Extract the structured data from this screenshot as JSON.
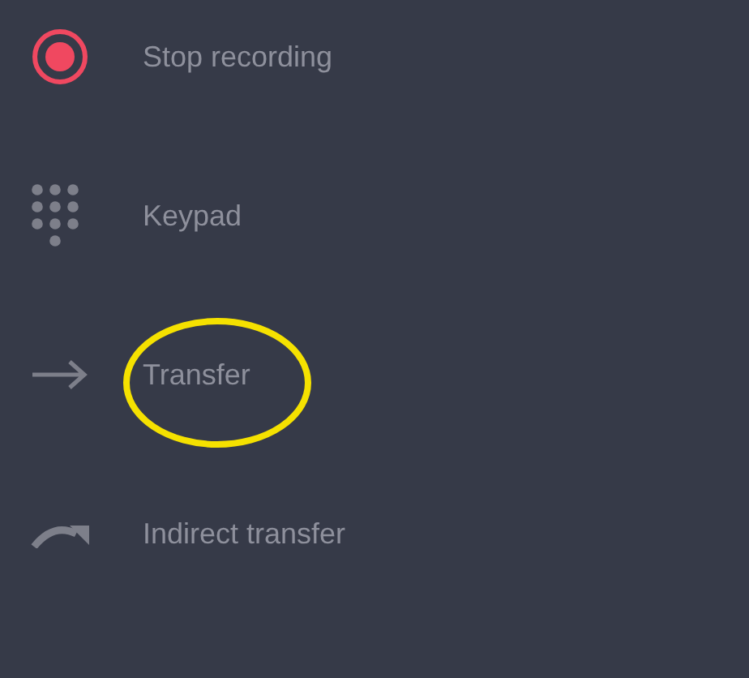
{
  "menu": {
    "items": [
      {
        "kind": "record",
        "label": "Stop recording",
        "circled": false
      },
      {
        "kind": "keypad",
        "label": "Keypad",
        "circled": false
      },
      {
        "kind": "arrow",
        "label": "Transfer",
        "circled": true
      },
      {
        "kind": "curved-arrow",
        "label": "Indirect transfer",
        "circled": false
      }
    ]
  }
}
